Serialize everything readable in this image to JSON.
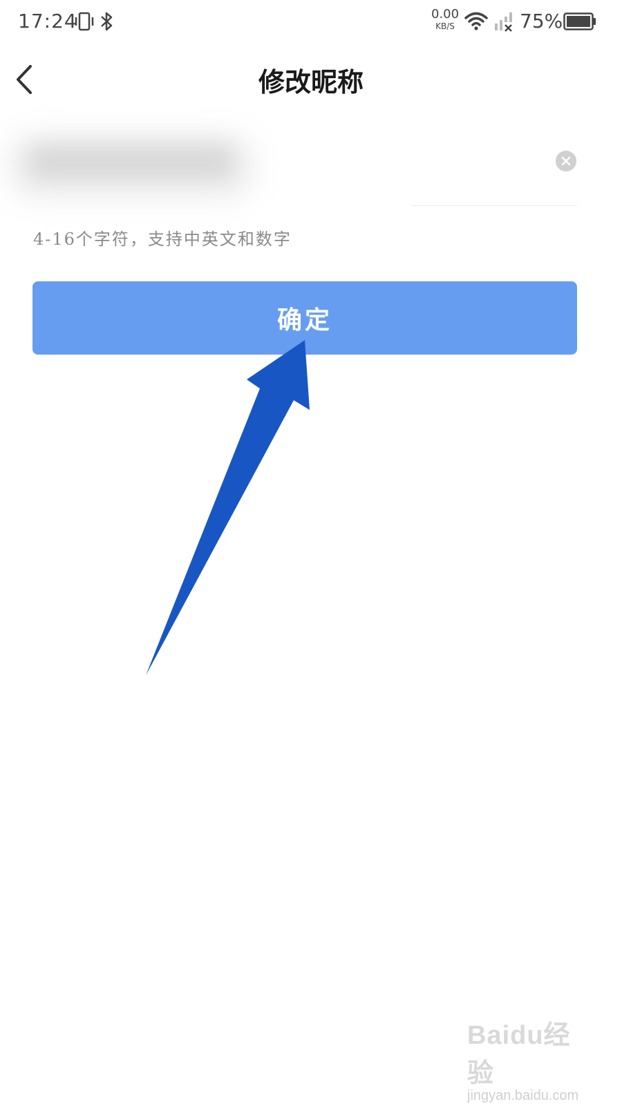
{
  "status_bar": {
    "time": "17:24",
    "net_speed_value": "0.00",
    "net_speed_unit": "KB/S",
    "battery_percent": "75%",
    "icons": [
      "vibrate-icon",
      "bluetooth-icon",
      "wifi-icon",
      "signal-no-service-icon",
      "battery-icon"
    ]
  },
  "header": {
    "back_icon": "chevron-left-icon",
    "title": "修改昵称"
  },
  "nickname_field": {
    "value": "",
    "clear_icon": "clear-circle-icon"
  },
  "hint": "4-16个字符，支持中英文和数字",
  "confirm_button": {
    "label": "确定",
    "color": "#669df0"
  },
  "annotation": {
    "arrow_color": "#1857c3"
  },
  "watermark": {
    "logo": "Baidu经验",
    "url": "jingyan.baidu.com"
  }
}
